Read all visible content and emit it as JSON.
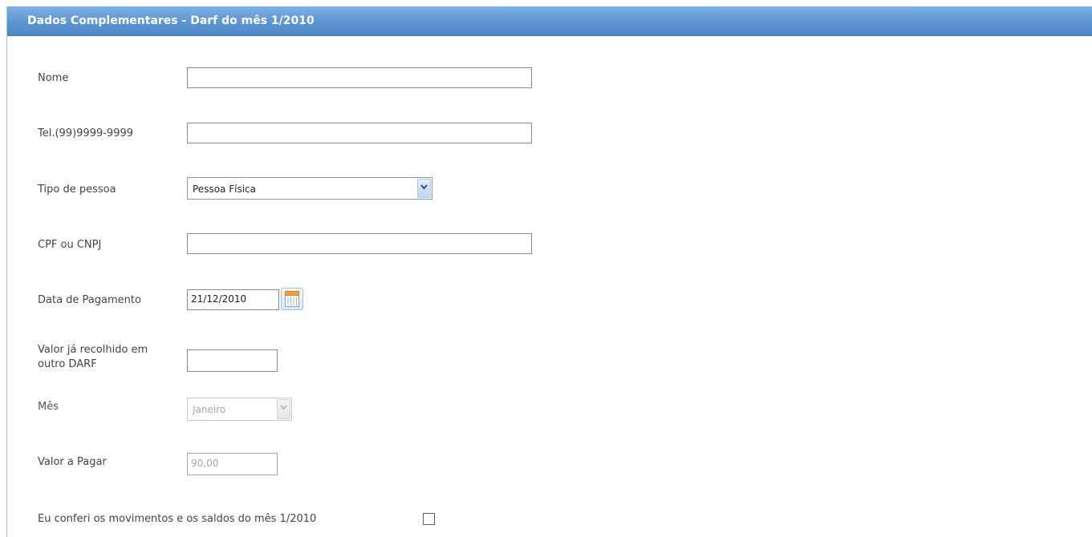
{
  "panel": {
    "title": "Dados Complementares - Darf do mês 1/2010"
  },
  "form": {
    "nome": {
      "label": "Nome",
      "value": ""
    },
    "telefone": {
      "label": "Tel.(99)9999-9999",
      "value": ""
    },
    "tipo_pessoa": {
      "label": "Tipo de pessoa",
      "selected": "Pessoa Física"
    },
    "cpf_cnpj": {
      "label": "CPF ou CNPJ",
      "value": ""
    },
    "data_pagamento": {
      "label": "Data de Pagamento",
      "value": "21/12/2010"
    },
    "valor_recolhido": {
      "label_line1": "Valor já recolhido em",
      "label_line2": "outro DARF",
      "value": ""
    },
    "mes": {
      "label": "Mês",
      "selected": "Janeiro",
      "enabled": false
    },
    "valor_pagar": {
      "label": "Valor a Pagar",
      "value": "90,00",
      "enabled": false
    },
    "confirmacao": {
      "label": "Eu conferi os movimentos e os saldos do mês 1/2010",
      "checked": false
    }
  },
  "icons": {
    "dropdown": "chevron-down-icon",
    "calendar": "calendar-icon"
  },
  "colors": {
    "header_top": "#7fb0e2",
    "header_bottom": "#4c86c7",
    "header_text": "#ffffff",
    "label_text": "#444444",
    "disabled_text": "#a8a8a8",
    "calendar_accent": "#f0a030"
  }
}
